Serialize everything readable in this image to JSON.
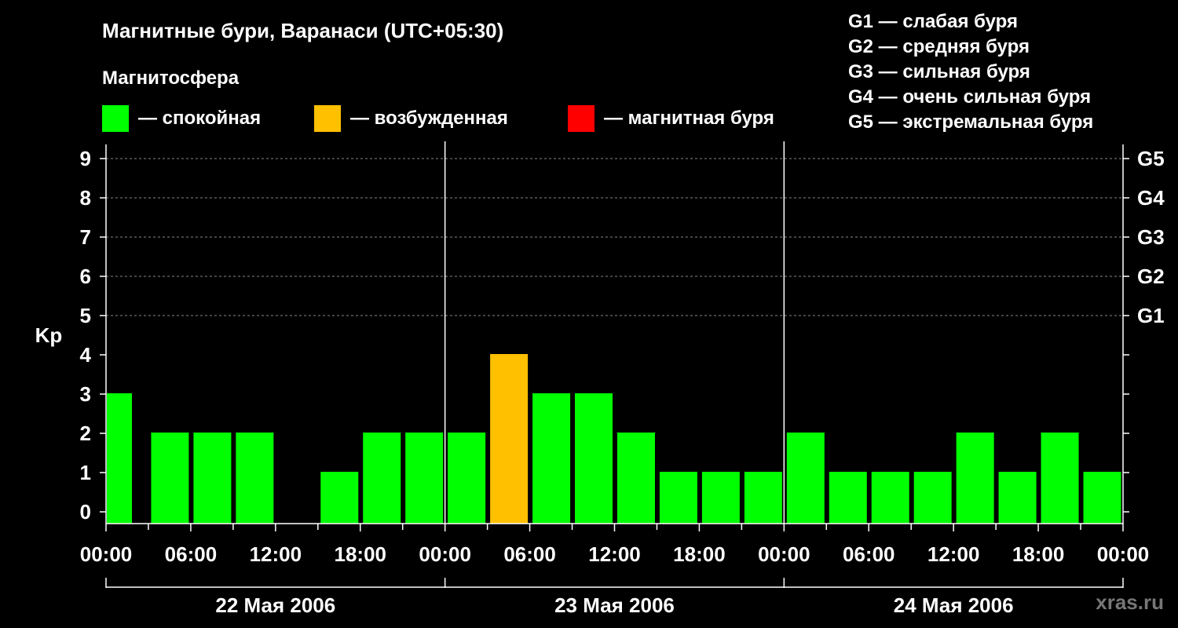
{
  "header": {
    "title": "Магнитные бури, Варанаси (UTC+05:30)",
    "subtitle": "Магнитосфера"
  },
  "legend": [
    {
      "label": "— спокойная",
      "color": "#00ff00"
    },
    {
      "label": "— возбужденная",
      "color": "#ffc000"
    },
    {
      "label": "— магнитная буря",
      "color": "#ff0000"
    }
  ],
  "g_legend": [
    "G1 — слабая буря",
    "G2 — средняя буря",
    "G3 — сильная буря",
    "G4 — очень сильная буря",
    "G5 — экстремальная буря"
  ],
  "watermark": "xras.ru",
  "chart_data": {
    "type": "bar",
    "ylabel": "Kp",
    "ylim": [
      0,
      9
    ],
    "yticks": [
      0,
      1,
      2,
      3,
      4,
      5,
      6,
      7,
      8,
      9
    ],
    "right_axis_labels": [
      {
        "kp": 5,
        "label": "G1"
      },
      {
        "kp": 6,
        "label": "G2"
      },
      {
        "kp": 7,
        "label": "G3"
      },
      {
        "kp": 8,
        "label": "G4"
      },
      {
        "kp": 9,
        "label": "G5"
      }
    ],
    "grid": "dashed horizontal at 5–9",
    "xtick_labels": [
      "00:00",
      "06:00",
      "12:00",
      "18:00",
      "00:00",
      "06:00",
      "12:00",
      "18:00",
      "00:00",
      "06:00",
      "12:00",
      "18:00",
      "00:00"
    ],
    "days": [
      "22 Мая 2006",
      "23 Мая 2006",
      "24 Мая 2006"
    ],
    "interval_hours": 3,
    "colors": {
      "quiet": "#00ff00",
      "active": "#ffc000",
      "storm": "#ff0000"
    },
    "values": [
      3,
      2,
      2,
      2,
      0,
      1,
      2,
      2,
      2,
      4,
      3,
      3,
      2,
      1,
      1,
      1,
      2,
      1,
      1,
      1,
      2,
      1,
      2,
      1
    ]
  }
}
